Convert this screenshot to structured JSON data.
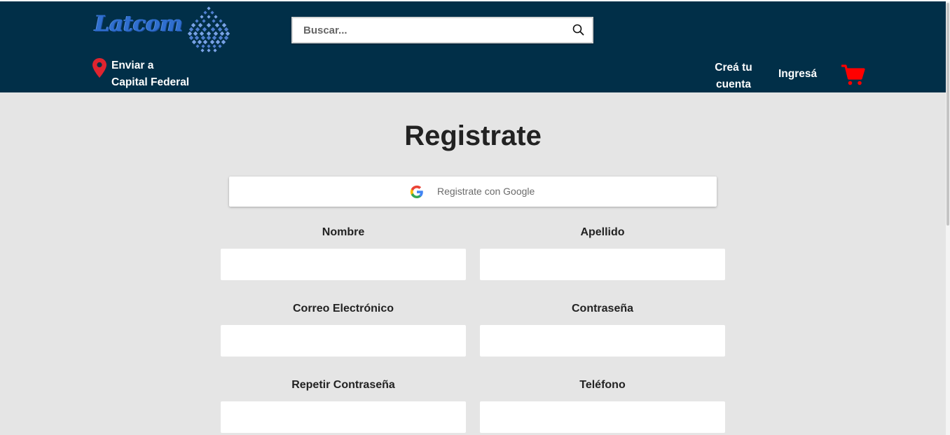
{
  "header": {
    "logo_text": "Latcom",
    "search": {
      "placeholder": "Buscar..."
    },
    "location": {
      "line1": "Enviar a",
      "line2": "Capital Federal"
    },
    "create_account": {
      "line1": "Creá tu",
      "line2": "cuenta"
    },
    "login_label": "Ingresá",
    "colors": {
      "background": "#012f48",
      "pin": "#e0242f",
      "cart": "#ff0000"
    }
  },
  "form": {
    "title": "Registrate",
    "google_label": "Registrate con Google",
    "fields": {
      "first_name": {
        "label": "Nombre",
        "value": ""
      },
      "last_name": {
        "label": "Apellido",
        "value": ""
      },
      "email": {
        "label": "Correo Electrónico",
        "value": ""
      },
      "password": {
        "label": "Contraseña",
        "value": ""
      },
      "repeat_password": {
        "label": "Repetir Contraseña",
        "value": ""
      },
      "phone": {
        "label": "Teléfono",
        "value": ""
      }
    }
  },
  "icons": {
    "logo_mark": "diamond-grid-logo-icon",
    "search": "search-icon",
    "location": "location-pin-icon",
    "cart": "shopping-cart-icon",
    "google": "google-g-icon"
  },
  "page": {
    "background": "#e5e5e5"
  }
}
